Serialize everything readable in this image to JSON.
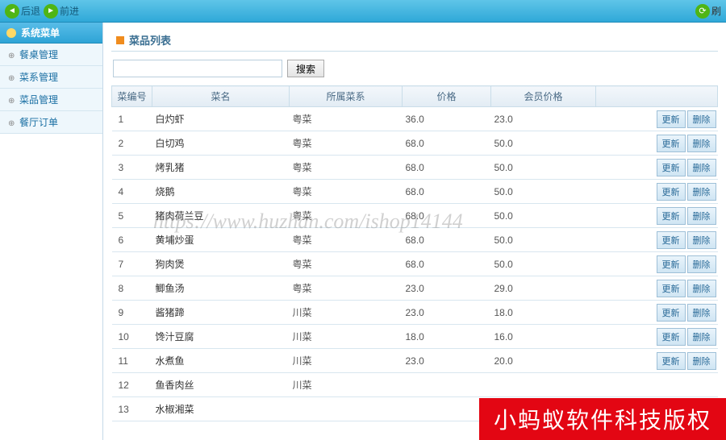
{
  "toolbar": {
    "back_label": "后退",
    "forward_label": "前进",
    "refresh_label": "刷"
  },
  "sidebar": {
    "header": "系统菜单",
    "items": [
      {
        "label": "餐桌管理"
      },
      {
        "label": "菜系管理"
      },
      {
        "label": "菜品管理"
      },
      {
        "label": "餐厅订单"
      }
    ]
  },
  "panel": {
    "title": "菜品列表",
    "search_button": "搜索",
    "search_value": ""
  },
  "table": {
    "headers": [
      "菜编号",
      "菜名",
      "所属菜系",
      "价格",
      "会员价格",
      ""
    ],
    "update_label": "更新",
    "delete_label": "删除",
    "rows": [
      {
        "id": "1",
        "name": "白灼虾",
        "category": "粤菜",
        "price": "36.0",
        "member_price": "23.0"
      },
      {
        "id": "2",
        "name": "白切鸡",
        "category": "粤菜",
        "price": "68.0",
        "member_price": "50.0"
      },
      {
        "id": "3",
        "name": "烤乳猪",
        "category": "粤菜",
        "price": "68.0",
        "member_price": "50.0"
      },
      {
        "id": "4",
        "name": "烧鹅",
        "category": "粤菜",
        "price": "68.0",
        "member_price": "50.0"
      },
      {
        "id": "5",
        "name": "猪肉荷兰豆",
        "category": "粤菜",
        "price": "68.0",
        "member_price": "50.0"
      },
      {
        "id": "6",
        "name": "黄埔炒蛋",
        "category": "粤菜",
        "price": "68.0",
        "member_price": "50.0"
      },
      {
        "id": "7",
        "name": "狗肉煲",
        "category": "粤菜",
        "price": "68.0",
        "member_price": "50.0"
      },
      {
        "id": "8",
        "name": "鲫鱼汤",
        "category": "粤菜",
        "price": "23.0",
        "member_price": "29.0"
      },
      {
        "id": "9",
        "name": "酱猪蹄",
        "category": "川菜",
        "price": "23.0",
        "member_price": "18.0"
      },
      {
        "id": "10",
        "name": "馋汁豆腐",
        "category": "川菜",
        "price": "18.0",
        "member_price": "16.0"
      },
      {
        "id": "11",
        "name": "水煮鱼",
        "category": "川菜",
        "price": "23.0",
        "member_price": "20.0"
      },
      {
        "id": "12",
        "name": "鱼香肉丝",
        "category": "川菜",
        "price": "",
        "member_price": ""
      },
      {
        "id": "13",
        "name": "水椒湘菜",
        "category": "",
        "price": "",
        "member_price": ""
      }
    ]
  },
  "watermark": "https://www.huzhan.com/ishop14144",
  "footer": "小蚂蚁软件科技版权"
}
